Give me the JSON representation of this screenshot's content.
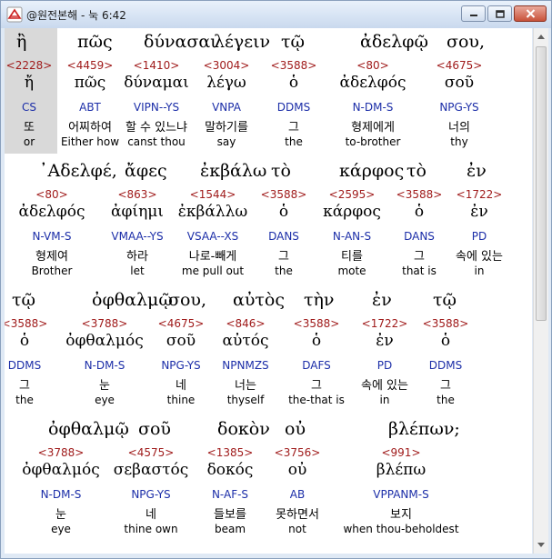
{
  "window": {
    "title": "@원전본해 - 눅 6:42"
  },
  "verse_rows": [
    {
      "tokens": [
        {
          "word": "ἢ",
          "strong": "<2228>",
          "lemma": "ἤ",
          "parse": "CS",
          "korean": "또",
          "english": "or",
          "highlighted": true
        },
        {
          "word": "πῶς",
          "strong": "<4459>",
          "lemma": "πῶς",
          "parse": "ABT",
          "korean": "어찌하여",
          "english": "Either how"
        },
        {
          "word": "δύνασαι",
          "strong": "<1410>",
          "lemma": "δύναμαι",
          "parse": "VIPN--YS",
          "korean": "할 수 있느냐",
          "english": "canst thou"
        },
        {
          "word": "λέγειν",
          "strong": "<3004>",
          "lemma": "λέγω",
          "parse": "VNPA",
          "korean": "말하기를",
          "english": "say"
        },
        {
          "word": "τῷ",
          "strong": "<3588>",
          "lemma": "ὁ",
          "parse": "DDMS",
          "korean": "그",
          "english": "the"
        },
        {
          "word": "ἀδελφῷ",
          "strong": "<80>",
          "lemma": "ἀδελφός",
          "parse": "N-DM-S",
          "korean": "형제에게",
          "english": "to-brother"
        },
        {
          "word": "σου,",
          "strong": "<4675>",
          "lemma": "σοῦ",
          "parse": "NPG-YS",
          "korean": "너의",
          "english": "thy"
        }
      ]
    },
    {
      "tokens": [
        {
          "word": "᾿Αδελφέ,",
          "strong": "<80>",
          "lemma": "ἀδελφός",
          "parse": "N-VM-S",
          "korean": "형제여",
          "english": "Brother"
        },
        {
          "word": "ἄφες",
          "strong": "<863>",
          "lemma": "ἀφίημι",
          "parse": "VMAA--YS",
          "korean": "하라",
          "english": "let"
        },
        {
          "word": "ἐκβάλω",
          "strong": "<1544>",
          "lemma": "ἐκβάλλω",
          "parse": "VSAA--XS",
          "korean": "나로-빼게",
          "english": "me pull out"
        },
        {
          "word": "τὸ",
          "strong": "<3588>",
          "lemma": "ὁ",
          "parse": "DANS",
          "korean": "그",
          "english": "the"
        },
        {
          "word": "κάρφος",
          "strong": "<2595>",
          "lemma": "κάρφος",
          "parse": "N-AN-S",
          "korean": "티를",
          "english": "mote"
        },
        {
          "word": "τὸ",
          "strong": "<3588>",
          "lemma": "ὁ",
          "parse": "DANS",
          "korean": "그",
          "english": "that is"
        },
        {
          "word": "ἐν",
          "strong": "<1722>",
          "lemma": "ἐν",
          "parse": "PD",
          "korean": "속에 있는",
          "english": "in"
        }
      ]
    },
    {
      "tokens": [
        {
          "word": "τῷ",
          "strong": "<3588>",
          "lemma": "ὁ",
          "parse": "DDMS",
          "korean": "그",
          "english": "the"
        },
        {
          "word": "ὀφθαλμῷ",
          "strong": "<3788>",
          "lemma": "ὀφθαλμός",
          "parse": "N-DM-S",
          "korean": "눈",
          "english": "eye"
        },
        {
          "word": "σου,",
          "strong": "<4675>",
          "lemma": "σοῦ",
          "parse": "NPG-YS",
          "korean": "네",
          "english": "thine"
        },
        {
          "word": "αὐτὸς",
          "strong": "<846>",
          "lemma": "αὐτός",
          "parse": "NPNMZS",
          "korean": "너는",
          "english": "thyself"
        },
        {
          "word": "τὴν",
          "strong": "<3588>",
          "lemma": "ὁ",
          "parse": "DAFS",
          "korean": "그",
          "english": "the-that is"
        },
        {
          "word": "ἐν",
          "strong": "<1722>",
          "lemma": "ἐν",
          "parse": "PD",
          "korean": "속에 있는",
          "english": "in"
        },
        {
          "word": "τῷ",
          "strong": "<3588>",
          "lemma": "ὁ",
          "parse": "DDMS",
          "korean": "그",
          "english": "the"
        }
      ]
    },
    {
      "tokens": [
        {
          "word": "ὀφθαλμῷ",
          "strong": "<3788>",
          "lemma": "ὀφθαλμός",
          "parse": "N-DM-S",
          "korean": "눈",
          "english": "eye"
        },
        {
          "word": "σοῦ",
          "strong": "<4575>",
          "lemma": "σεβαστός",
          "parse": "NPG-YS",
          "korean": "네",
          "english": "thine own"
        },
        {
          "word": "δοκὸν",
          "strong": "<1385>",
          "lemma": "δοκός",
          "parse": "N-AF-S",
          "korean": "들보를",
          "english": "beam"
        },
        {
          "word": "οὐ",
          "strong": "<3756>",
          "lemma": "οὐ",
          "parse": "AB",
          "korean": "못하면서",
          "english": "not"
        },
        {
          "word": "βλέπων;",
          "strong": "<991>",
          "lemma": "βλέπω",
          "parse": "VPPANM-S",
          "korean": "보지",
          "english": "when thou-beholdest"
        }
      ]
    }
  ],
  "colors": {
    "strong": "#a01c1c",
    "parse": "#1c2ea8",
    "highlight": "#d9d9d9"
  }
}
